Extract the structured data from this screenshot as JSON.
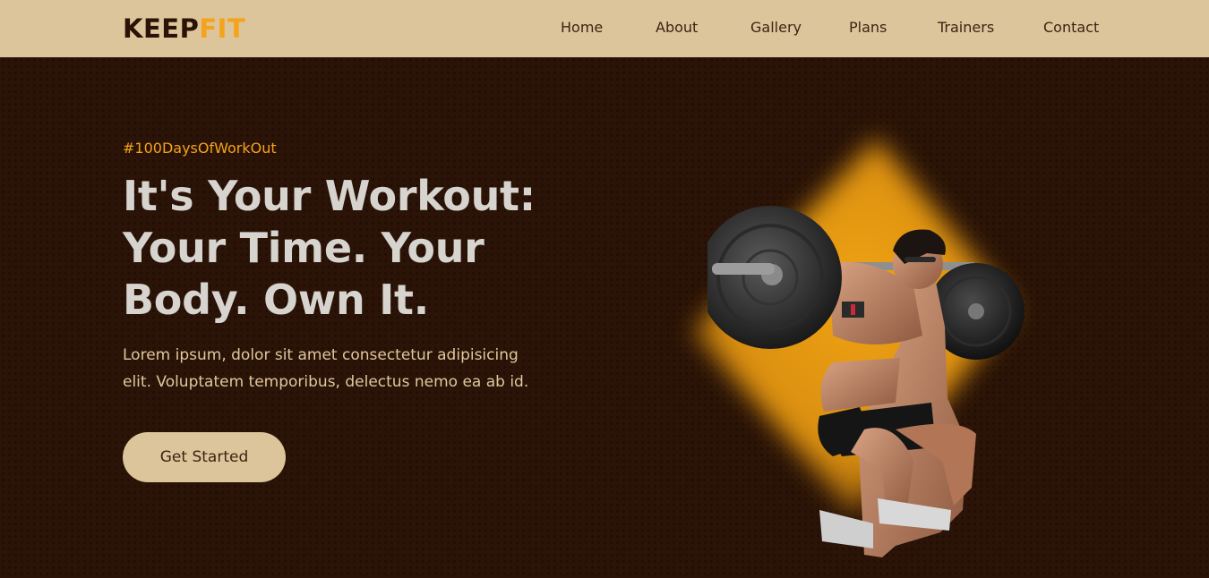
{
  "brand": {
    "logo_primary": "KEEP",
    "logo_accent": "FIT"
  },
  "nav": {
    "items": [
      "Home",
      "About",
      "Gallery",
      "Plans",
      "Trainers",
      "Contact"
    ],
    "active": "Home"
  },
  "hero": {
    "tagline": "#100DaysOfWorkOut",
    "headline_lines": [
      "It's Your Workout:",
      "Your Time. Your",
      "Body. Own It."
    ],
    "description_lines": [
      "Lorem ipsum, dolor sit amet consectetur adipisicing",
      "elit. Voluptatem temporibus, delectus nemo ea ab id."
    ],
    "cta_label": "Get Started"
  },
  "colors": {
    "nav_bg": "#dcc59a",
    "page_bg": "#2b1407",
    "accent": "#f5a31a",
    "headline": "#d7d3cf",
    "body_text": "#dfc79d"
  }
}
